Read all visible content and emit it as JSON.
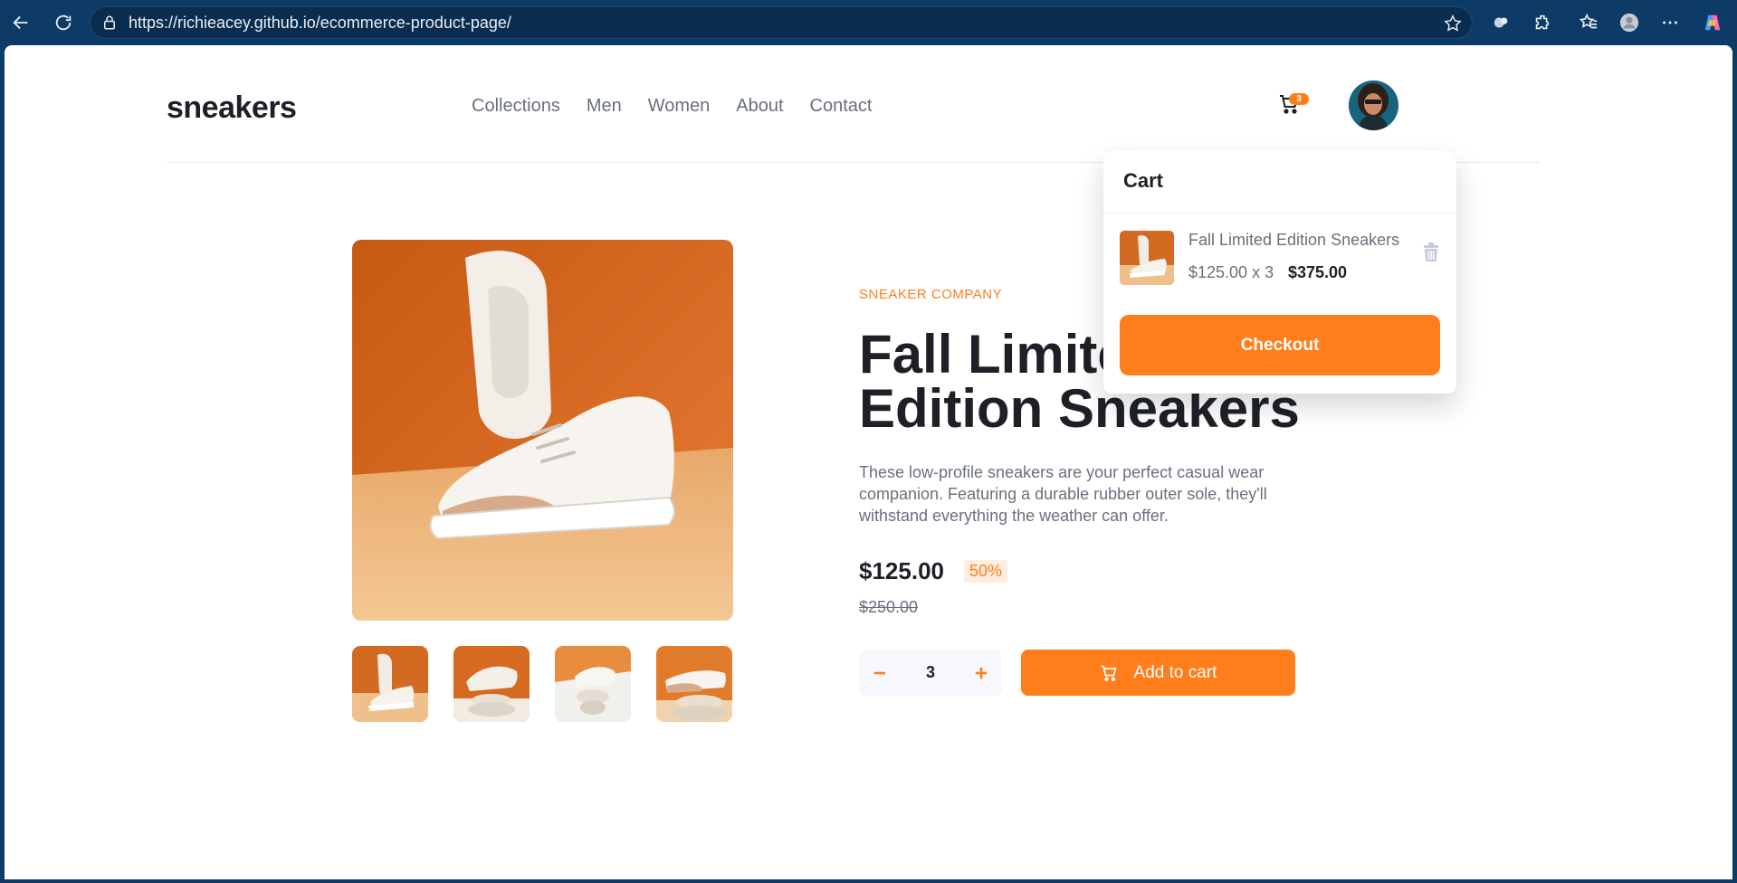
{
  "browser": {
    "url": "https://richieacey.github.io/ecommerce-product-page/",
    "icons": [
      "back-icon",
      "refresh-icon",
      "lock-icon",
      "star-icon",
      "extensions-icon",
      "favorites-icon",
      "profile-icon",
      "more-icon",
      "copilot-icon"
    ]
  },
  "header": {
    "logo": "sneakers",
    "nav": [
      "Collections",
      "Men",
      "Women",
      "About",
      "Contact"
    ],
    "cart_count": "3"
  },
  "product": {
    "brand": "SNEAKER COMPANY",
    "title": "Fall Limited Edition Sneakers",
    "description": "These low-profile sneakers are your perfect casual wear companion. Featuring a durable rubber outer sole, they'll withstand everything the weather can offer.",
    "price": "$125.00",
    "discount": "50%",
    "original_price": "$250.00",
    "quantity": "3",
    "add_to_cart_label": "Add to cart"
  },
  "cart": {
    "title": "Cart",
    "item_name": "Fall Limited Edition Sneakers",
    "item_calc": "$125.00 x 3",
    "item_total": "$375.00",
    "checkout_label": "Checkout"
  },
  "colors": {
    "accent": "#ff7e1b",
    "browser_frame": "#0d3b66",
    "text_dark": "#1d2026",
    "text_muted": "#69707d"
  }
}
